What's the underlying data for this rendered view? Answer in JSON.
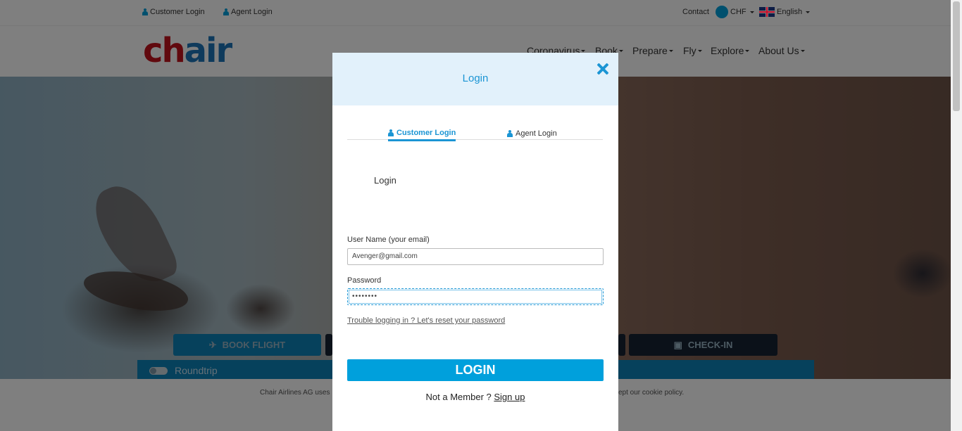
{
  "topbar": {
    "customer_login": "Customer Login",
    "agent_login": "Agent Login",
    "contact": "Contact",
    "currency": "CHF",
    "language": "English"
  },
  "logo": {
    "part1": "ch",
    "part2": "air"
  },
  "nav": {
    "items": [
      "Coronavirus",
      "Book",
      "Prepare",
      "Fly",
      "Explore",
      "About Us"
    ]
  },
  "booking_tabs": {
    "book_flight": "BOOK FLIGHT",
    "check_in": "CHECK-IN"
  },
  "roundtrip": {
    "label": "Roundtrip"
  },
  "cookie": {
    "left_text": "Chair Airlines AG uses",
    "right_text": "ept our cookie policy."
  },
  "modal": {
    "title": "Login",
    "tabs": {
      "customer": "Customer Login",
      "agent": "Agent Login"
    },
    "section_title": "Login",
    "username": {
      "label": "User Name (your email)",
      "value": "Avenger@gmail.com"
    },
    "password": {
      "label": "Password",
      "value": "••••••••"
    },
    "reset_link": "Trouble logging in ? Let's reset your password",
    "login_button": "LOGIN",
    "member_text": "Not a Member ?",
    "signup_link": "Sign up"
  },
  "colors": {
    "accent": "#00a0dc",
    "brand_red": "#c2121c",
    "brand_blue": "#1c74b8"
  }
}
